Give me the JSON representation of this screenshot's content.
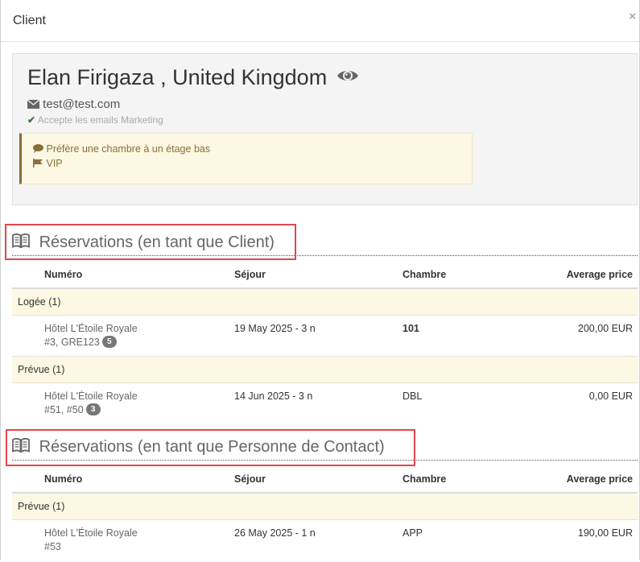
{
  "modal": {
    "title": "Client",
    "close_label": "×"
  },
  "client": {
    "name": "Elan Firigaza , United Kingdom",
    "email": "test@test.com",
    "marketing": "Accepte les emails Marketing",
    "notes": [
      {
        "icon": "comment-icon",
        "text": "Préfère une chambre à un étage bas"
      },
      {
        "icon": "flag-icon",
        "text": "VIP"
      }
    ]
  },
  "sections": [
    {
      "title": "Réservations (en tant que Client)",
      "columns": {
        "numero": "Numéro",
        "sejour": "Séjour",
        "chambre": "Chambre",
        "price": "Average price"
      },
      "groups": [
        {
          "label": "Logée (1)",
          "rows": [
            {
              "hotel": "Hôtel L'Étoile Royale",
              "ref": "#3, GRE123",
              "badge": "5",
              "sejour": "19 May 2025 - 3 n",
              "chambre": "101",
              "price": "200,00 EUR"
            }
          ]
        },
        {
          "label": "Prévue (1)",
          "rows": [
            {
              "hotel": "Hôtel L'Étoile Royale",
              "ref": "#51, #50",
              "badge": "3",
              "sejour": "14 Jun 2025 - 3 n",
              "chambre": "DBL",
              "price": "0,00 EUR"
            }
          ]
        }
      ]
    },
    {
      "title": "Réservations (en tant que Personne de Contact)",
      "columns": {
        "numero": "Numéro",
        "sejour": "Séjour",
        "chambre": "Chambre",
        "price": "Average price"
      },
      "groups": [
        {
          "label": "Prévue (1)",
          "rows": [
            {
              "hotel": "Hôtel L'Étoile Royale",
              "ref": "#53",
              "badge": "",
              "sejour": "26 May 2025 - 1 n",
              "chambre": "APP",
              "price": "190,00 EUR"
            }
          ]
        }
      ]
    }
  ]
}
